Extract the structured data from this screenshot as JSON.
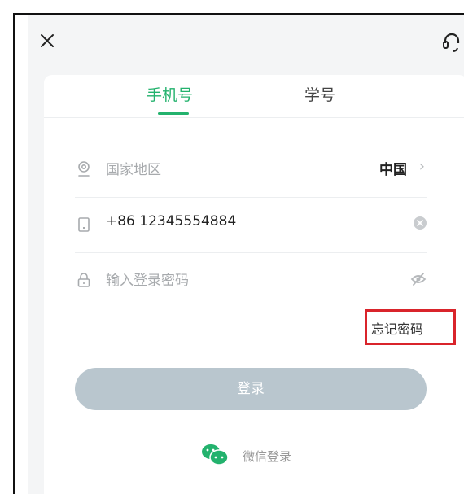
{
  "tabs": {
    "phone": "手机号",
    "student_id": "学号"
  },
  "region": {
    "label": "国家地区",
    "value": "中国"
  },
  "phone": {
    "value": "+86  12345554884"
  },
  "password": {
    "placeholder": "输入登录密码"
  },
  "forgot_password": "忘记密码",
  "login_button": "登录",
  "wechat_login": "微信登录",
  "colors": {
    "accent": "#23b26d",
    "login_button_bg": "#b9c6ce",
    "highlight_box": "#d9242b"
  },
  "icons": [
    "close-icon",
    "headset-icon",
    "location-pin-icon",
    "phone-icon",
    "lock-icon",
    "clear-icon",
    "eye-hidden-icon",
    "wechat-icon"
  ]
}
